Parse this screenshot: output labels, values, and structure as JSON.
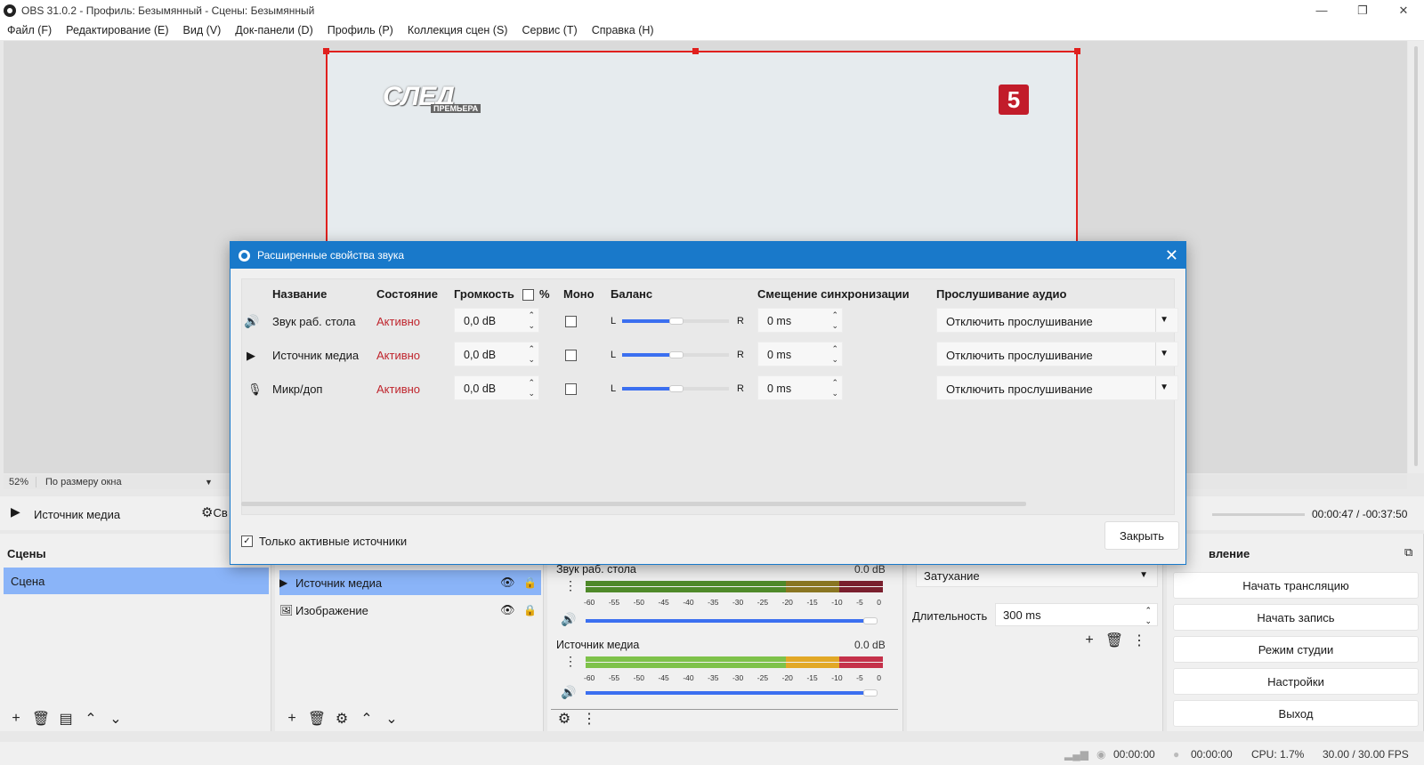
{
  "window": {
    "title": "OBS 31.0.2 - Профиль: Безымянный - Сцены: Безымянный",
    "minimize": "—",
    "maximize": "❐",
    "close": "✕"
  },
  "menu": [
    "Файл (F)",
    "Редактирование (E)",
    "Вид (V)",
    "Док-панели (D)",
    "Профиль (P)",
    "Коллекция сцен (S)",
    "Сервис (T)",
    "Справка (H)"
  ],
  "preview": {
    "logo_left": "СЛЕД",
    "logo_left_sub": "ПРЕМЬЕРА",
    "logo_right": "5",
    "zoom_percent": "52%",
    "zoom_mode": "По размеру окна"
  },
  "media_controls": {
    "source": "Источник медиа",
    "settings_label": "Св",
    "time": "00:00:47  /  -00:37:50"
  },
  "scenes": {
    "title": "Сцены",
    "items": [
      "Сцена"
    ]
  },
  "sources": {
    "items": [
      {
        "name": "Источник медиа",
        "icon": "play-icon"
      },
      {
        "name": "Изображение",
        "icon": "image-icon"
      }
    ]
  },
  "mixer": {
    "channels": [
      {
        "name": "Звук раб. стола",
        "db": "0.0 dB"
      },
      {
        "name": "Источник медиа",
        "db": "0.0 dB"
      }
    ],
    "ticks": [
      "-60",
      "-55",
      "-50",
      "-45",
      "-40",
      "-35",
      "-30",
      "-25",
      "-20",
      "-15",
      "-10",
      "-5",
      "0"
    ]
  },
  "transitions": {
    "selected": "Затухание",
    "duration_label": "Длительность",
    "duration_value": "300 ms"
  },
  "controls": {
    "title": "вление",
    "buttons": [
      "Начать трансляцию",
      "Начать запись",
      "Режим студии",
      "Настройки",
      "Выход"
    ]
  },
  "status": {
    "stream_time": "00:00:00",
    "rec_time": "00:00:00",
    "cpu": "CPU: 1.7%",
    "fps": "30.00 / 30.00 FPS"
  },
  "dialog": {
    "title": "Расширенные свойства звука",
    "headers": {
      "name": "Название",
      "status": "Состояние",
      "volume": "Громкость",
      "percent": "%",
      "mono": "Моно",
      "balance": "Баланс",
      "sync": "Смещение синхронизации",
      "monitoring": "Прослушивание аудио"
    },
    "rows": [
      {
        "icon": "speaker-icon",
        "name": "Звук раб. стола",
        "status": "Активно",
        "volume": "0,0 dB",
        "mono": false,
        "balance_l": "L",
        "balance_r": "R",
        "balance": 0.5,
        "sync": "0 ms",
        "monitoring": "Отключить прослушивание"
      },
      {
        "icon": "play-icon",
        "name": "Источник медиа",
        "status": "Активно",
        "volume": "0,0 dB",
        "mono": false,
        "balance_l": "L",
        "balance_r": "R",
        "balance": 0.5,
        "sync": "0 ms",
        "monitoring": "Отключить прослушивание"
      },
      {
        "icon": "microphone-icon",
        "name": "Микр/доп",
        "status": "Активно",
        "volume": "0,0 dB",
        "mono": false,
        "balance_l": "L",
        "balance_r": "R",
        "balance": 0.5,
        "sync": "0 ms",
        "monitoring": "Отключить прослушивание"
      }
    ],
    "only_active_label": "Только активные источники",
    "only_active_checked": true,
    "close_button": "Закрыть"
  }
}
